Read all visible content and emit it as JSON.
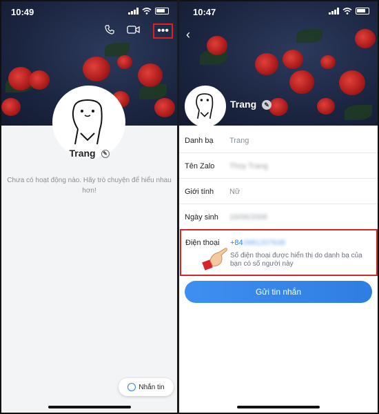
{
  "left_screen": {
    "status": {
      "time": "10:49"
    },
    "profile": {
      "name": "Trang"
    },
    "empty_message": "Chưa có hoạt động nào. Hãy trò chuyện để hiểu nhau hơn!",
    "message_button": "Nhắn tin",
    "more_icon": "•••",
    "icons": [
      "call-icon",
      "video-call-icon",
      "more-options-icon"
    ]
  },
  "right_screen": {
    "status": {
      "time": "10:47"
    },
    "profile": {
      "name": "Trang"
    },
    "info": [
      {
        "label": "Danh bạ",
        "value": "Trang"
      },
      {
        "label": "Tên Zalo",
        "value": "Thùy Trang"
      },
      {
        "label": "Giới tính",
        "value": "Nữ"
      },
      {
        "label": "Ngày sinh",
        "value": "16/06/2006"
      }
    ],
    "phone": {
      "label": "Điện thoại",
      "prefix": "+84",
      "number_hidden": "0981207638",
      "note": "Số điện thoại được hiển thị do danh bạ của bạn có số người này"
    },
    "send_button": "Gửi tin nhắn",
    "back_icon": "‹"
  },
  "colors": {
    "accent": "#2f7de1",
    "highlight_border": "#d8232a"
  }
}
